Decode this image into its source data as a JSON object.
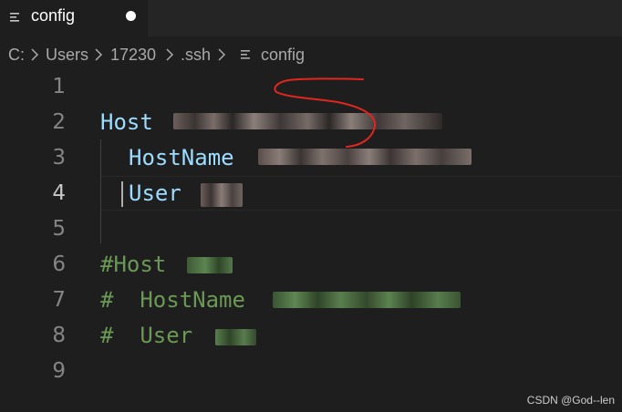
{
  "tab": {
    "label": "config",
    "icon": "file-lines-icon",
    "unsaved": true
  },
  "breadcrumb": {
    "items": [
      "C:",
      "Users",
      "17230",
      ".ssh",
      "config"
    ],
    "file_icon": "file-lines-icon"
  },
  "editor": {
    "active_line": 4,
    "line_numbers": [
      "1",
      "2",
      "3",
      "4",
      "5",
      "6",
      "7",
      "8",
      "9"
    ],
    "lines": {
      "l2_keyword": "Host",
      "l3_keyword": "HostName",
      "l4_keyword": "User",
      "l6_text": "#Host",
      "l7_text": "#  HostName",
      "l8_text": "#  User"
    },
    "redacted_note": "values pixelated"
  },
  "watermark": "CSDN @God--len",
  "colors": {
    "background": "#1e1e1e",
    "keyword": "#9cdcfe",
    "comment": "#6a9955",
    "annotation": "#e0261e"
  }
}
